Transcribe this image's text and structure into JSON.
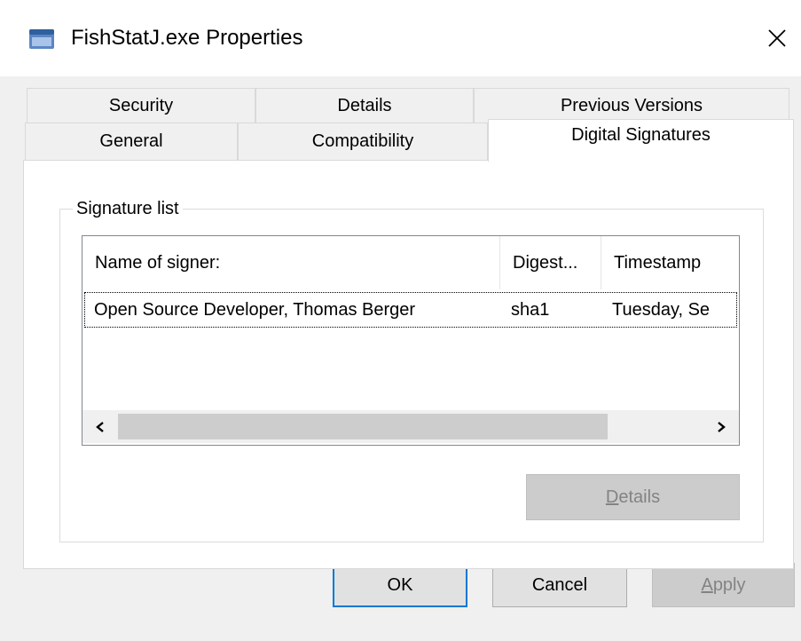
{
  "window": {
    "title": "FishStatJ.exe Properties"
  },
  "tabs": {
    "row1": [
      {
        "label": "Security"
      },
      {
        "label": "Details"
      },
      {
        "label": "Previous Versions"
      }
    ],
    "row2": [
      {
        "label": "General"
      },
      {
        "label": "Compatibility"
      },
      {
        "label": "Digital Signatures",
        "selected": true
      }
    ]
  },
  "signature_group": {
    "label": "Signature list",
    "columns": [
      {
        "label": "Name of signer:"
      },
      {
        "label": "Digest..."
      },
      {
        "label": "Timestamp"
      }
    ],
    "rows": [
      {
        "signer": "Open Source Developer, Thomas Berger",
        "digest": "sha1",
        "timestamp": "Tuesday, Se"
      }
    ],
    "details_button": {
      "mnemonic": "D",
      "rest": "etails",
      "enabled": false
    }
  },
  "footer": {
    "ok_label": "OK",
    "cancel_label": "Cancel",
    "apply": {
      "mnemonic": "A",
      "rest": "pply",
      "enabled": false
    }
  },
  "icons": {
    "app": "application-window-icon",
    "close": "close-icon",
    "scroll_left": "chevron-left-icon",
    "scroll_right": "chevron-right-icon"
  },
  "colors": {
    "accent": "#0078d7",
    "window_bg": "#f0f0f0",
    "panel_bg": "#ffffff",
    "disabled_text": "#838383"
  }
}
